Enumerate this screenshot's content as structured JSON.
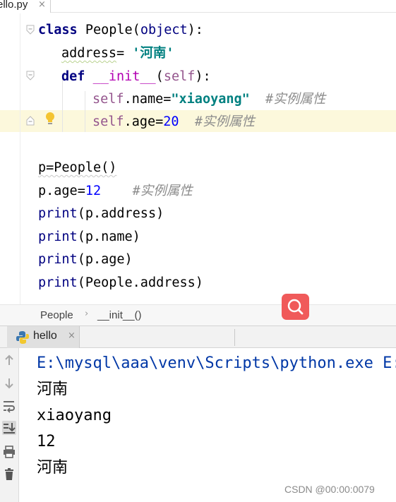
{
  "editor_tab": {
    "filename": "ello.py",
    "close": "×"
  },
  "code": {
    "l1_kw": "class",
    "l1_rest": " People(",
    "l1_base": "object",
    "l1_end": "):",
    "l2_a": "address",
    "l2_b": "= ",
    "l2_str": "'河南'",
    "l3_kw": "def",
    "l3_sp": " ",
    "l3_fn": "__init__",
    "l3_p": "(",
    "l3_self": "self",
    "l3_end": "):",
    "l4_self": "self",
    "l4_mid": ".name=",
    "l4_str": "\"xiaoyang\"",
    "l4_cmt": "  #实例属性",
    "l5_self": "self",
    "l5_mid": ".age=",
    "l5_num": "20",
    "l5_cmt": "  #实例属性",
    "l7": "p=People()",
    "l8_a": "p.age=",
    "l8_num": "12",
    "l8_cmt": "    #实例属性",
    "l9_fn": "print",
    "l9_rest": "(p.address)",
    "l10_fn": "print",
    "l10_rest": "(p.name)",
    "l11_fn": "print",
    "l11_rest": "(p.age)",
    "l12_fn": "print",
    "l12_rest": "(People.address)"
  },
  "breadcrumb": {
    "class": "People",
    "sep": "›",
    "method": "__init__()"
  },
  "run": {
    "tab_label": "hello",
    "tab_close": "×",
    "output": [
      "E:\\mysql\\aaa\\venv\\Scripts\\python.exe E:/",
      "河南",
      "xiaoyang",
      "12",
      "河南"
    ]
  },
  "toolbar_icons": [
    "up-arrow-icon",
    "down-arrow-icon",
    "soft-wrap-icon",
    "scroll-to-end-icon",
    "print-icon",
    "trash-icon"
  ],
  "watermark": "CSDN @00:00:0079",
  "colors": {
    "highlight_line": "#fcf8dc",
    "search_button": "#f05a5a",
    "keyword": "#000080",
    "string": "#008080",
    "number": "#0000ff"
  }
}
